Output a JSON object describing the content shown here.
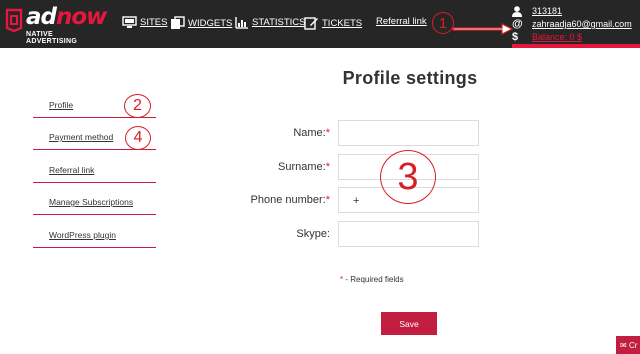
{
  "header": {
    "brand_word_left": "ad",
    "brand_word_right": "now",
    "brand_tagline": "NATIVE ADVERTISING",
    "nav": [
      {
        "label": "SITES",
        "icon": "monitor-icon"
      },
      {
        "label": "WIDGETS",
        "icon": "widgets-icon"
      },
      {
        "label": "STATISTICS",
        "icon": "bar-chart-icon"
      },
      {
        "label": "TICKETS",
        "icon": "ticket-edit-icon"
      }
    ],
    "referral_link": "Referral link",
    "user": {
      "id": "313181",
      "email": "zahraadja60@gmail.com",
      "balance": "Balance: 0 $"
    },
    "icons": {
      "user": "user-icon",
      "email": "at-icon",
      "balance": "dollar-icon"
    }
  },
  "annotations": [
    "1",
    "2",
    "3",
    "4"
  ],
  "sidebar": {
    "items": [
      {
        "label": "Profile"
      },
      {
        "label": "Payment method"
      },
      {
        "label": "Referral link"
      },
      {
        "label": "Manage Subscriptions"
      },
      {
        "label": "WordPress plugin"
      }
    ]
  },
  "form": {
    "title": "Profile settings",
    "fields": [
      {
        "label": "Name:",
        "required": "*",
        "value": ""
      },
      {
        "label": "Surname:",
        "required": "*",
        "value": ""
      },
      {
        "label": "Phone number:",
        "required": "*",
        "prefix": "+",
        "value": ""
      },
      {
        "label": "Skype:",
        "value": ""
      }
    ],
    "required_star": "*",
    "required_note": " - Required fields",
    "save_label": "Save"
  },
  "chat_tab": "Cr",
  "colors": {
    "accent": "#c21e41",
    "header_bg": "#262626",
    "annotation": "#d81f26"
  }
}
